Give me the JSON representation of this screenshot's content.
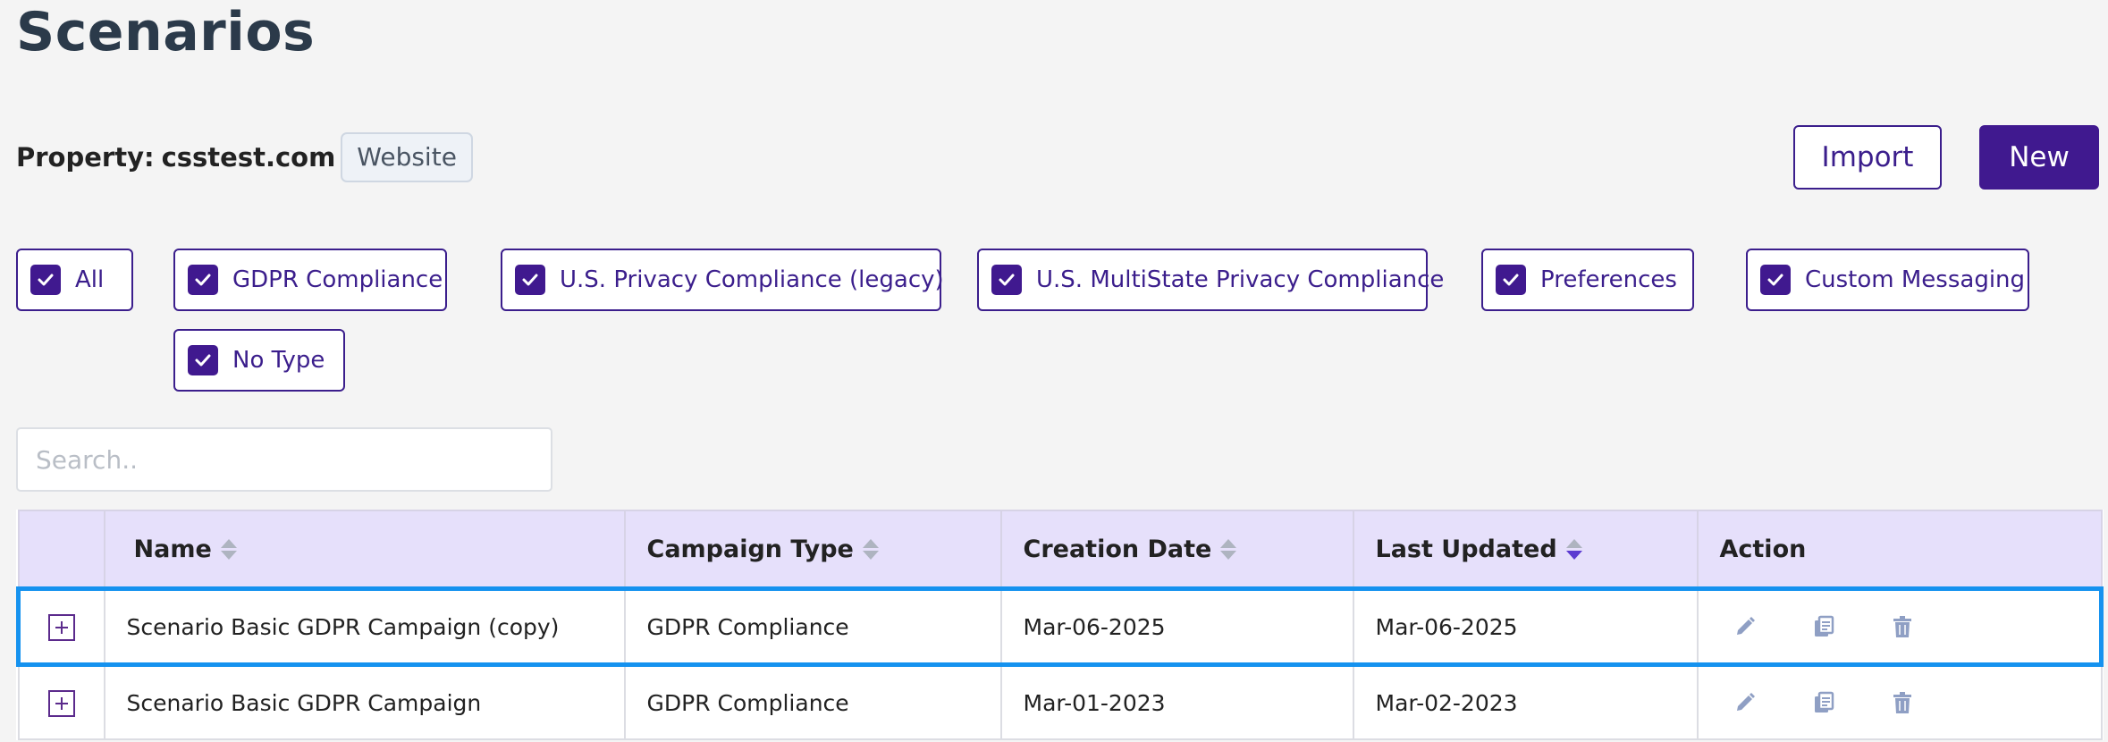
{
  "page": {
    "title": "Scenarios"
  },
  "property": {
    "label": "Property:",
    "value": "csstest.com",
    "badge": "Website"
  },
  "buttons": {
    "import_label": "Import",
    "new_label": "New"
  },
  "filters": [
    {
      "label": "All",
      "checked": true
    },
    {
      "label": "GDPR Compliance",
      "checked": true
    },
    {
      "label": "U.S. Privacy Compliance (legacy)",
      "checked": true
    },
    {
      "label": "U.S. MultiState Privacy Compliance",
      "checked": true
    },
    {
      "label": "Preferences",
      "checked": true
    },
    {
      "label": "Custom Messaging",
      "checked": true
    },
    {
      "label": "No Type",
      "checked": true
    }
  ],
  "search": {
    "placeholder": "Search..",
    "value": ""
  },
  "table": {
    "columns": [
      {
        "label": "",
        "sortable": false
      },
      {
        "label": "Name",
        "sortable": true,
        "sort": "none"
      },
      {
        "label": "Campaign Type",
        "sortable": true,
        "sort": "none"
      },
      {
        "label": "Creation Date",
        "sortable": true,
        "sort": "none"
      },
      {
        "label": "Last Updated",
        "sortable": true,
        "sort": "desc"
      },
      {
        "label": "Action",
        "sortable": false
      }
    ],
    "rows": [
      {
        "name": "Scenario Basic GDPR Campaign (copy)",
        "campaign_type": "GDPR Compliance",
        "creation_date": "Mar-06-2025",
        "last_updated": "Mar-06-2025",
        "selected": true
      },
      {
        "name": "Scenario Basic GDPR Campaign",
        "campaign_type": "GDPR Compliance",
        "creation_date": "Mar-01-2023",
        "last_updated": "Mar-02-2023",
        "selected": false
      }
    ]
  },
  "icons": {
    "expand": "plus-box-icon",
    "edit": "pencil-icon",
    "copy": "copy-icon",
    "delete": "trash-icon",
    "sort": "sort-arrows-icon",
    "checkbox": "checkmark-icon"
  },
  "colors": {
    "brand": "#40198f",
    "header_bg": "#e6e0fb",
    "selected_outline": "#1592ef",
    "action_icon": "#8f9fc4",
    "sort_inactive": "#aeb4c0",
    "sort_active": "#5b3ad1"
  }
}
